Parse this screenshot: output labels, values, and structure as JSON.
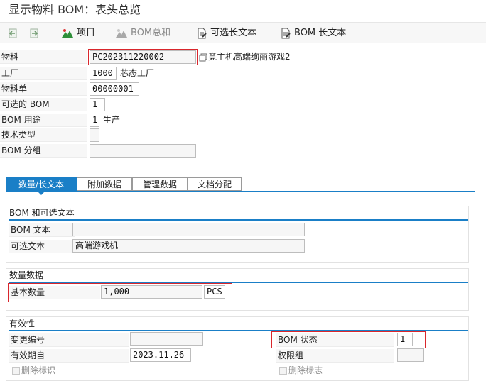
{
  "window": {
    "title": "显示物料 BOM：表头总览"
  },
  "toolbar": {
    "project_label": "项目",
    "bom_sum_label": "BOM总和",
    "alt_text_label": "可选长文本",
    "bom_long_text_label": "BOM 长文本"
  },
  "header": {
    "material_label": "物料",
    "material_value": "PC202311220002",
    "material_desc": "竟主机高端绚丽游戏2",
    "plant_label": "工厂",
    "plant_value": "1000",
    "plant_desc": "芯态工厂",
    "material_bom_label": "物料单",
    "material_bom_value": "00000001",
    "alt_bom_label": "可选的 BOM",
    "alt_bom_value": "1",
    "bom_usage_label": "BOM 用途",
    "bom_usage_value": "1",
    "bom_usage_desc": "生产",
    "tech_type_label": "技术类型",
    "tech_type_value": "",
    "bom_group_label": "BOM 分组",
    "bom_group_value": ""
  },
  "tabs": [
    "数量/长文本",
    "附加数据",
    "管理数据",
    "文档分配"
  ],
  "groups": {
    "bom_text": {
      "title": "BOM 和可选文本",
      "bom_text_label": "BOM 文本",
      "bom_text_value": "",
      "alt_text_label": "可选文本",
      "alt_text_value": "高端游戏机"
    },
    "quantity": {
      "title": "数量数据",
      "base_qty_label": "基本数量",
      "base_qty_value": "1,000",
      "unit_value": "PCS"
    },
    "validity": {
      "title": "有效性",
      "change_no_label": "变更编号",
      "change_no_value": "",
      "valid_from_label": "有效期自",
      "valid_from_value": "2023.11.26",
      "deletion_flag_label": "删除标识",
      "bom_status_label": "BOM 状态",
      "bom_status_value": "1",
      "auth_group_label": "权限组",
      "auth_group_value": "",
      "delete_flag_label": "删除标志"
    }
  },
  "colors": {
    "accent": "#1a7fc7",
    "highlight": "#d9262c"
  }
}
